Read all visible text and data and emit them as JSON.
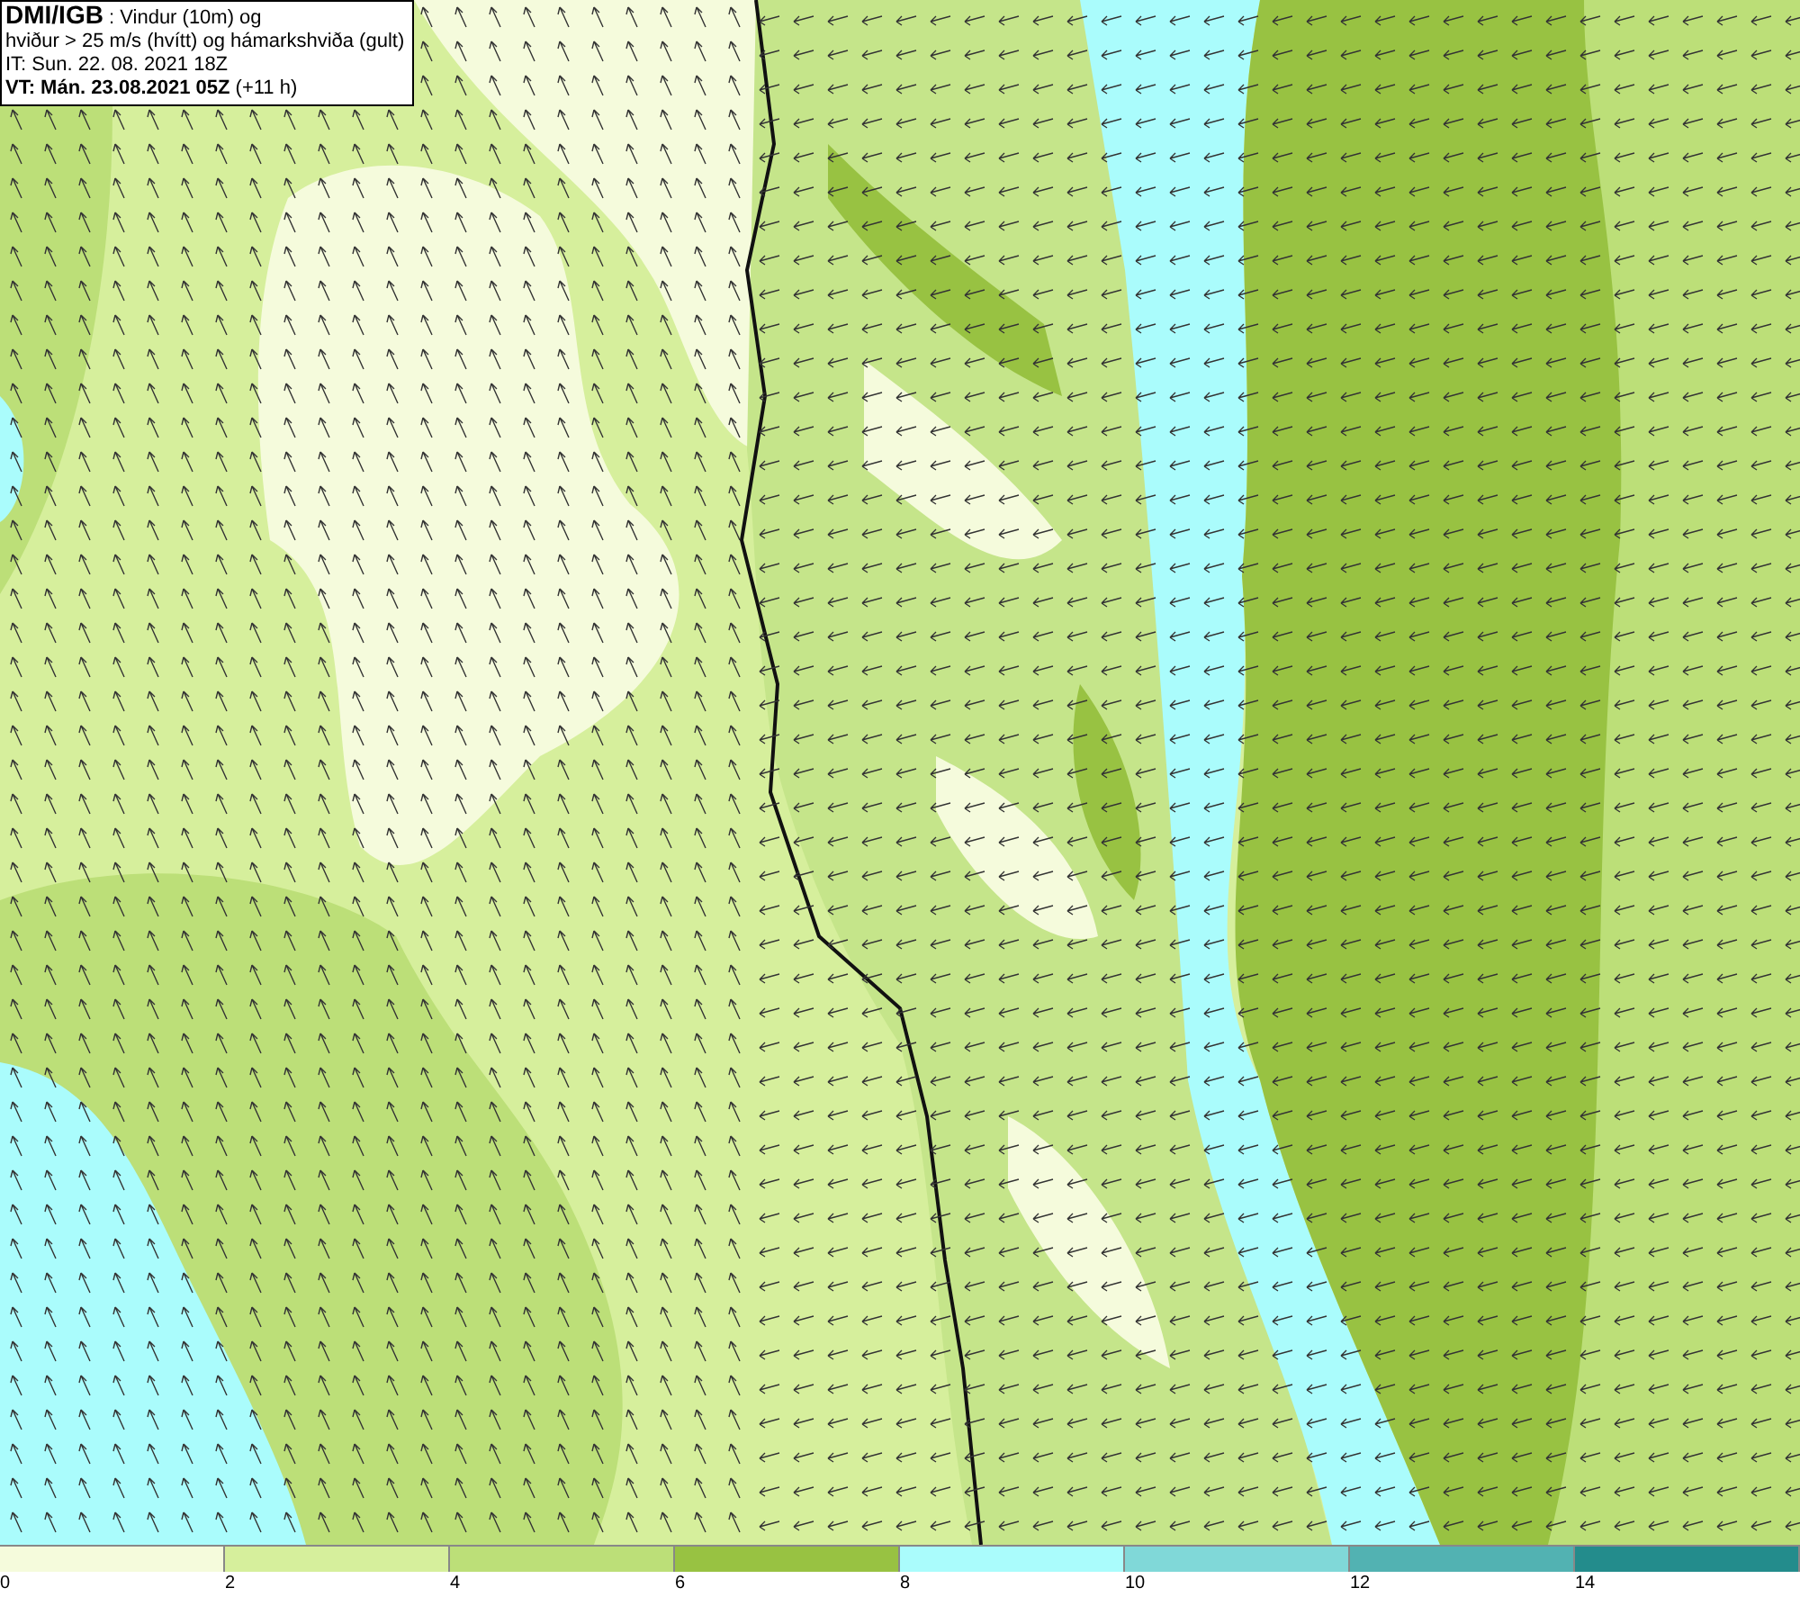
{
  "header": {
    "lines": [
      "**DMI/IGB** : Vindur (10m) og",
      "hviður > 25 m/s (hvítt) og hámarkshviða (gult)",
      "IT: Sun. 22. 08. 2021 18Z",
      "**VT: Mán. 23.08.2021 05Z** (+11 h)"
    ]
  },
  "legend": {
    "bins": [
      {
        "color": "#f5fbdc"
      },
      {
        "color": "#d6ef9c"
      },
      {
        "color": "#bcdf78"
      },
      {
        "color": "#98c242"
      },
      {
        "color": "#aafcfc"
      },
      {
        "color": "#80d8d8"
      },
      {
        "color": "#52b2b2"
      },
      {
        "color": "#238c8c"
      }
    ],
    "ticks": [
      "0",
      "2",
      "4",
      "6",
      "8",
      "10",
      "12",
      "14"
    ]
  }
}
